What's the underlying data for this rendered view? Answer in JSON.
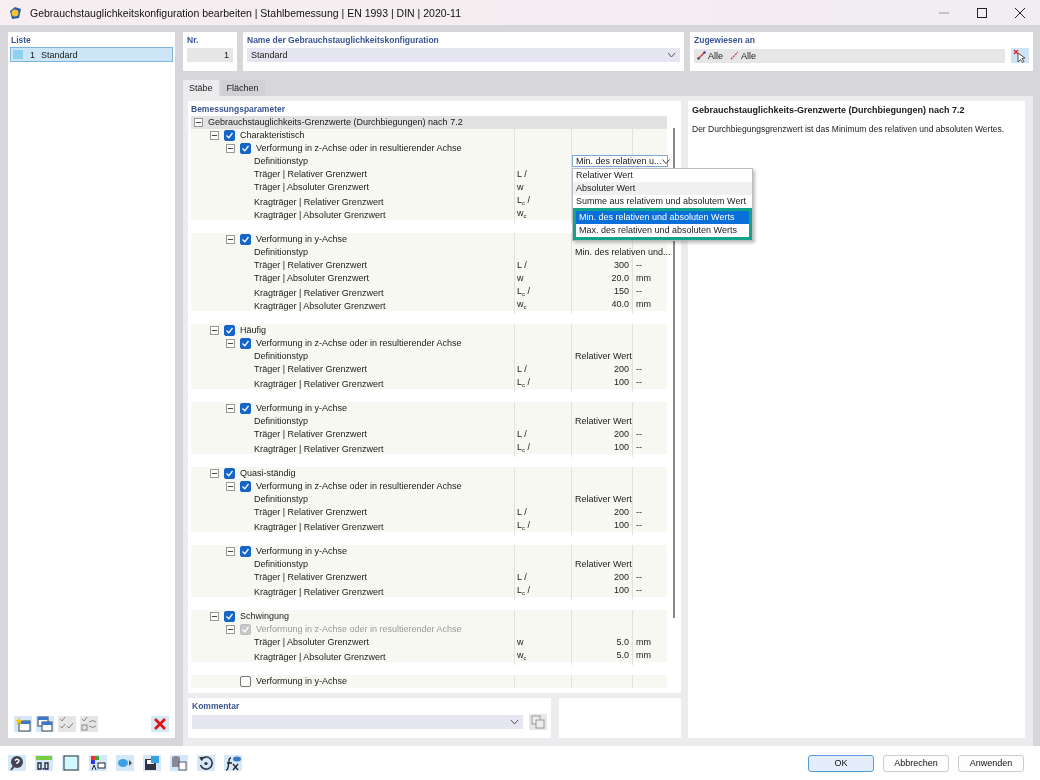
{
  "window": {
    "title": "Gebrauchstauglichkeitskonfiguration bearbeiten | Stahlbemessung | EN 1993 | DIN | 2020-11"
  },
  "list": {
    "title": "Liste",
    "items": [
      {
        "number": "1",
        "label": "Standard",
        "selected": true
      }
    ]
  },
  "number": {
    "label": "Nr.",
    "value": "1"
  },
  "name": {
    "label": "Name der Gebrauchstauglichkeitskonfiguration",
    "value": "Standard"
  },
  "assigned": {
    "label": "Zugewiesen an",
    "items": [
      {
        "label": "Alle",
        "kind": "member"
      },
      {
        "label": "Alle",
        "kind": "set"
      }
    ]
  },
  "tabs": [
    {
      "label": "Stäbe",
      "selected": true
    },
    {
      "label": "Flächen",
      "selected": false
    }
  ],
  "parameters": {
    "title": "Bemessungsparameter",
    "tree": {
      "kind": "heading",
      "label": "Gebrauchstauglichkeits-Grenzwerte (Durchbiegungen) nach 7.2",
      "expanded": true,
      "children": [
        {
          "kind": "group",
          "label": "Charakteristisch",
          "checked": true,
          "expanded": true,
          "children": [
            {
              "kind": "section",
              "label": "Verformung in z-Achse oder in resultierender Achse",
              "checked": true,
              "disabled": false,
              "expanded": true,
              "children": [
                {
                  "kind": "param",
                  "label": "Definitionstyp",
                  "dropdown": {
                    "value": "Min. des relativen u...",
                    "open": true,
                    "options": [
                      {
                        "label": "Relativer Wert",
                        "selected": false,
                        "hovered": false,
                        "highlighted": false
                      },
                      {
                        "label": "Absoluter Wert",
                        "selected": false,
                        "hovered": true,
                        "highlighted": false
                      },
                      {
                        "label": "Summe aus relativem und absolutem Wert",
                        "selected": false,
                        "hovered": false,
                        "highlighted": false
                      },
                      {
                        "label": "Min. des relativen und absoluten Werts",
                        "selected": true,
                        "hovered": false,
                        "highlighted": true
                      },
                      {
                        "label": "Max. des relativen und absoluten Werts",
                        "selected": false,
                        "hovered": false,
                        "highlighted": true
                      }
                    ]
                  }
                },
                {
                  "kind": "param",
                  "label": "Träger | Relativer Grenzwert",
                  "symbol": "L /"
                },
                {
                  "kind": "param",
                  "label": "Träger | Absoluter Grenzwert",
                  "symbol": "w"
                },
                {
                  "kind": "param",
                  "label": "Kragträger | Relativer Grenzwert",
                  "symbol": "L$_{c}$ /"
                },
                {
                  "kind": "param",
                  "label": "Kragträger | Absoluter Grenzwert",
                  "symbol": "w$_{c}$"
                }
              ]
            },
            {
              "kind": "section",
              "label": "Verformung in y-Achse",
              "checked": true,
              "disabled": false,
              "expanded": true,
              "children": [
                {
                  "kind": "param",
                  "label": "Definitionstyp",
                  "value": "Min. des relativen und..."
                },
                {
                  "kind": "param",
                  "label": "Träger | Relativer Grenzwert",
                  "symbol": "L /",
                  "value": "300",
                  "unit": "--"
                },
                {
                  "kind": "param",
                  "label": "Träger | Absoluter Grenzwert",
                  "symbol": "w",
                  "value": "20.0",
                  "unit": "mm"
                },
                {
                  "kind": "param",
                  "label": "Kragträger | Relativer Grenzwert",
                  "symbol": "L$_{c}$ /",
                  "value": "150",
                  "unit": "--"
                },
                {
                  "kind": "param",
                  "label": "Kragträger | Absoluter Grenzwert",
                  "symbol": "w$_{c}$",
                  "value": "40.0",
                  "unit": "mm"
                }
              ]
            }
          ]
        },
        {
          "kind": "group",
          "label": "Häufig",
          "checked": true,
          "expanded": true,
          "children": [
            {
              "kind": "section",
              "label": "Verformung in z-Achse oder in resultierender Achse",
              "checked": true,
              "disabled": false,
              "expanded": true,
              "children": [
                {
                  "kind": "param",
                  "label": "Definitionstyp",
                  "value": "Relativer Wert"
                },
                {
                  "kind": "param",
                  "label": "Träger | Relativer Grenzwert",
                  "symbol": "L /",
                  "value": "200",
                  "unit": "--"
                },
                {
                  "kind": "param",
                  "label": "Kragträger | Relativer Grenzwert",
                  "symbol": "L$_{c}$ /",
                  "value": "100",
                  "unit": "--"
                }
              ]
            },
            {
              "kind": "section",
              "label": "Verformung in y-Achse",
              "checked": true,
              "disabled": false,
              "expanded": true,
              "children": [
                {
                  "kind": "param",
                  "label": "Definitionstyp",
                  "value": "Relativer Wert"
                },
                {
                  "kind": "param",
                  "label": "Träger | Relativer Grenzwert",
                  "symbol": "L /",
                  "value": "200",
                  "unit": "--"
                },
                {
                  "kind": "param",
                  "label": "Kragträger | Relativer Grenzwert",
                  "symbol": "L$_{c}$ /",
                  "value": "100",
                  "unit": "--"
                }
              ]
            }
          ]
        },
        {
          "kind": "group",
          "label": "Quasi-ständig",
          "checked": true,
          "expanded": true,
          "children": [
            {
              "kind": "section",
              "label": "Verformung in z-Achse oder in resultierender Achse",
              "checked": true,
              "disabled": false,
              "expanded": true,
              "children": [
                {
                  "kind": "param",
                  "label": "Definitionstyp",
                  "value": "Relativer Wert"
                },
                {
                  "kind": "param",
                  "label": "Träger | Relativer Grenzwert",
                  "symbol": "L /",
                  "value": "200",
                  "unit": "--"
                },
                {
                  "kind": "param",
                  "label": "Kragträger | Relativer Grenzwert",
                  "symbol": "L$_{c}$ /",
                  "value": "100",
                  "unit": "--"
                }
              ]
            },
            {
              "kind": "section",
              "label": "Verformung in y-Achse",
              "checked": true,
              "disabled": false,
              "expanded": true,
              "children": [
                {
                  "kind": "param",
                  "label": "Definitionstyp",
                  "value": "Relativer Wert"
                },
                {
                  "kind": "param",
                  "label": "Träger | Relativer Grenzwert",
                  "symbol": "L /",
                  "value": "200",
                  "unit": "--"
                },
                {
                  "kind": "param",
                  "label": "Kragträger | Relativer Grenzwert",
                  "symbol": "L$_{c}$ /",
                  "value": "100",
                  "unit": "--"
                }
              ]
            }
          ]
        },
        {
          "kind": "group",
          "label": "Schwingung",
          "checked": true,
          "expanded": true,
          "children": [
            {
              "kind": "section",
              "label": "Verformung in z-Achse oder in resultierender Achse",
              "checked": true,
              "disabled": true,
              "expanded": true,
              "children": [
                {
                  "kind": "param",
                  "label": "Träger | Absoluter Grenzwert",
                  "symbol": "w",
                  "value": "5.0",
                  "unit": "mm"
                },
                {
                  "kind": "param",
                  "label": "Kragträger | Absoluter Grenzwert",
                  "symbol": "w$_{c}$",
                  "value": "5.0",
                  "unit": "mm"
                }
              ]
            },
            {
              "kind": "section",
              "label": "Verformung in y-Achse",
              "checked": false,
              "disabled": false
            }
          ]
        }
      ]
    }
  },
  "description": {
    "title": "Gebrauchstauglichkeits-Grenzwerte (Durchbiegungen) nach 7.2",
    "text": "Der Durchbiegungsgrenzwert ist das Minimum des relativen und absoluten Wertes."
  },
  "comment": {
    "label": "Kommentar"
  },
  "buttons": [
    {
      "label": "OK",
      "default": true
    },
    {
      "label": "Abbrechen",
      "default": false
    },
    {
      "label": "Anwenden",
      "default": false
    }
  ]
}
